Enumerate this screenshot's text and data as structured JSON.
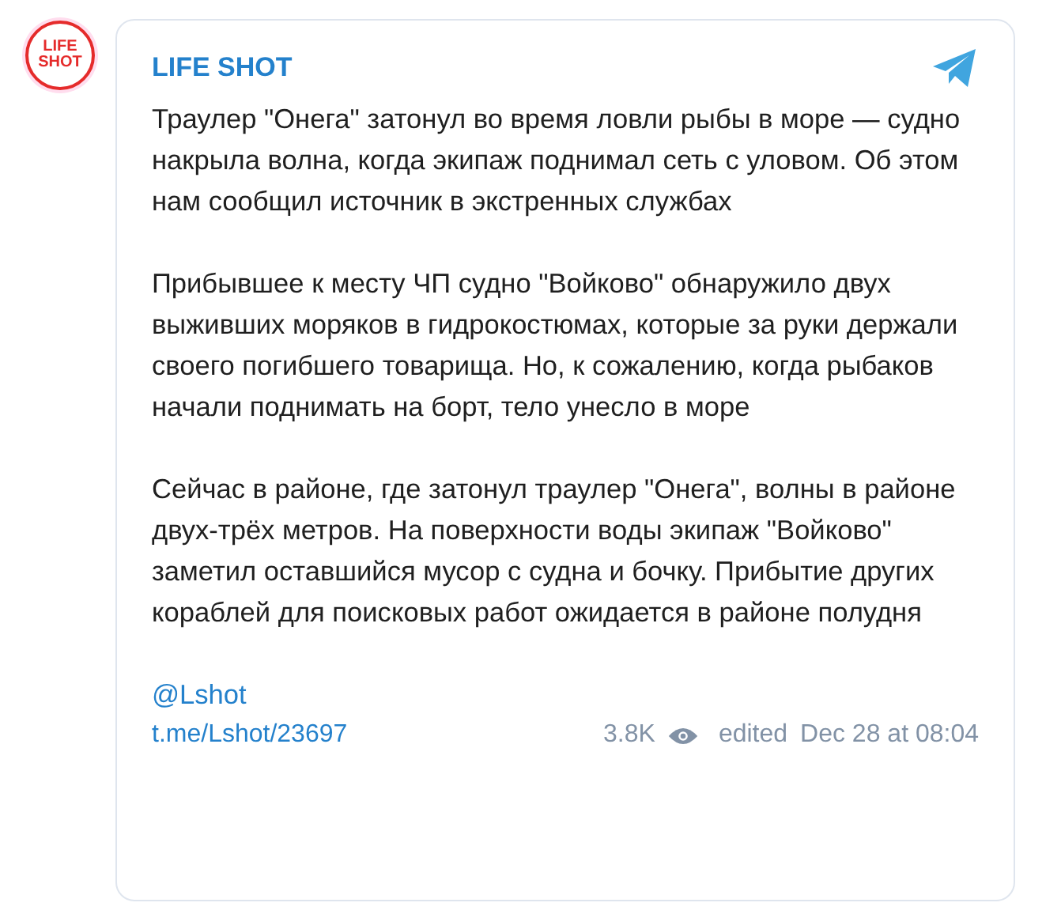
{
  "channel": {
    "logo_lines": [
      "LIFE",
      "SHOT"
    ],
    "name": "LIFE SHOT"
  },
  "post": {
    "paragraphs": [
      "Траулер \"Онега\" затонул во время ловли рыбы в море — судно накрыла волна, когда экипаж поднимал сеть с уловом. Об этом нам сообщил источник в экстренных службах",
      "Прибывшее к месту ЧП судно \"Войково\" обнаружило двух выживших моряков в гидрокостюмах, которые за руки держали своего погибшего товарища. Но, к сожалению, когда рыбаков начали поднимать на борт, тело унесло в море",
      "Сейчас в районе, где затонул траулер \"Онега\", волны в районе двух-трёх метров. На поверхности воды экипаж \"Войково\" заметил оставшийся мусор с судна и бочку. Прибытие других кораблей для поисковых работ ожидается в районе полудня"
    ],
    "mention": "@Lshot"
  },
  "footer": {
    "link": "t.me/Lshot/23697",
    "views": "3.8K",
    "edited": "edited",
    "date": "Dec 28 at 08:04"
  }
}
